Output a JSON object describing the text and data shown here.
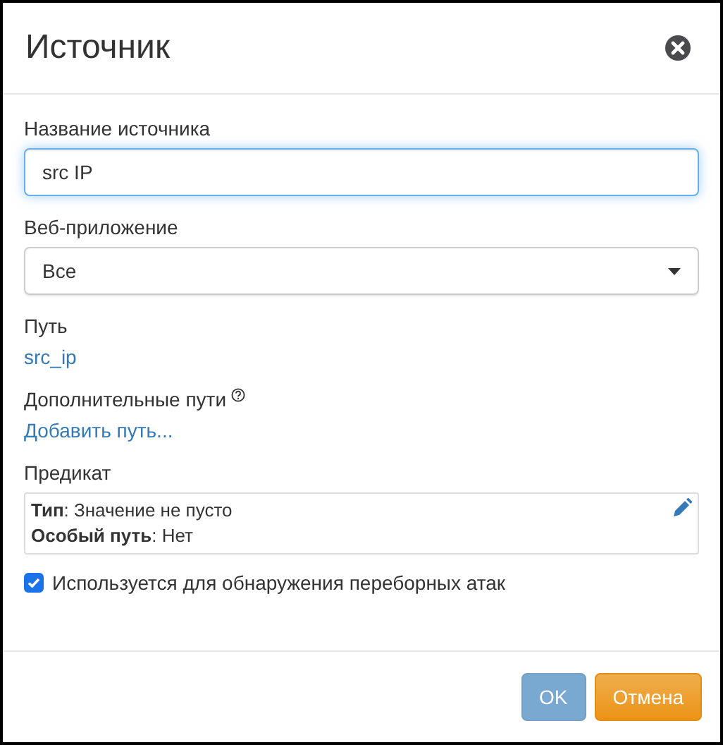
{
  "dialog": {
    "title": "Источник"
  },
  "fields": {
    "name": {
      "label": "Название источника",
      "value": "src IP",
      "focused": true
    },
    "webapp": {
      "label": "Веб-приложение",
      "value": "Все"
    },
    "path": {
      "label": "Путь",
      "link": "src_ip"
    },
    "extra_paths": {
      "label": "Дополнительные пути",
      "link": "Добавить путь..."
    },
    "predicate": {
      "label": "Предикат",
      "lines": [
        "**Тип**: Значение не пусто",
        "**Особый путь**: Нет"
      ]
    },
    "bruteforce": {
      "label": "Используется для обнаружения переборных атак",
      "checked": true
    }
  },
  "buttons": [
    {
      "label": "OK",
      "kind": "primary",
      "disabled": true
    },
    {
      "label": "Отмена",
      "kind": "cancel",
      "disabled": false
    }
  ]
}
